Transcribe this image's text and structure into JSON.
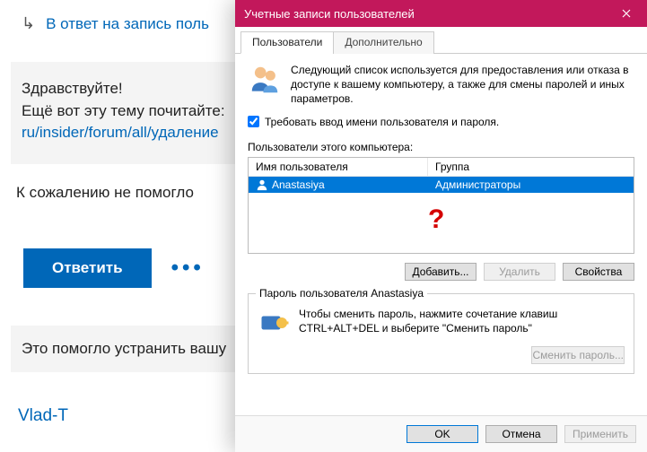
{
  "forum": {
    "reply_link": "В ответ на запись поль",
    "quote": {
      "hello": "Здравствуйте!",
      "line2": "Ещё вот эту тему почитайте:",
      "link": "ru/insider/forum/all/удаление"
    },
    "sorry": "К сожалению не помогло",
    "answer_btn": "Ответить",
    "helped_bar": "Это помогло устранить вашу",
    "username": "Vlad-T"
  },
  "dialog": {
    "title": "Учетные записи пользователей",
    "tabs": {
      "users": "Пользователи",
      "advanced": "Дополнительно"
    },
    "intro": "Следующий список используется для предоставления или отказа в доступе к вашему компьютеру, а также для смены паролей и иных параметров.",
    "require_checkbox": "Требовать ввод имени пользователя и пароля.",
    "require_checked": true,
    "list_label": "Пользователи этого компьютера:",
    "columns": {
      "name": "Имя пользователя",
      "group": "Группа"
    },
    "rows": [
      {
        "name": "Anastasiya",
        "group": "Администраторы"
      }
    ],
    "annotation_question": "?",
    "buttons": {
      "add": "Добавить...",
      "remove": "Удалить",
      "props": "Свойства"
    },
    "groupbox": {
      "title": "Пароль пользователя Anastasiya",
      "text": "Чтобы сменить пароль, нажмите сочетание клавиш CTRL+ALT+DEL и выберите \"Сменить пароль\"",
      "change_btn": "Сменить пароль..."
    },
    "footer": {
      "ok": "OK",
      "cancel": "Отмена",
      "apply": "Применить"
    }
  }
}
